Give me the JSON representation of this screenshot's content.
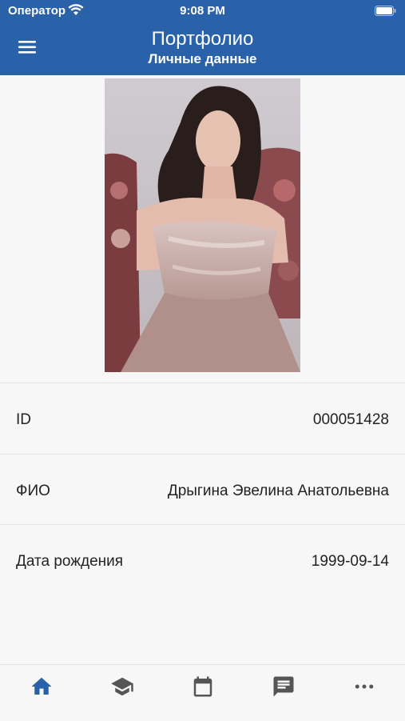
{
  "status_bar": {
    "carrier": "Оператор",
    "time": "9:08 PM"
  },
  "header": {
    "title": "Портфолио",
    "subtitle": "Личные данные"
  },
  "photo": {
    "description_icon": "profile-photo"
  },
  "fields": [
    {
      "label": "ID",
      "value": "000051428"
    },
    {
      "label": "ФИО",
      "value": "Дрыгина Эвелина Анатольевна"
    },
    {
      "label": "Дата рождения",
      "value": "1999-09-14"
    }
  ],
  "tabbar": {
    "active_color": "#2a62a9",
    "inactive_color": "#555555",
    "tabs": [
      "home-icon",
      "graduation-cap-icon",
      "calendar-icon",
      "message-icon",
      "more-icon"
    ]
  },
  "colors": {
    "accent": "#2a62a9",
    "background": "#f7f7f7"
  }
}
